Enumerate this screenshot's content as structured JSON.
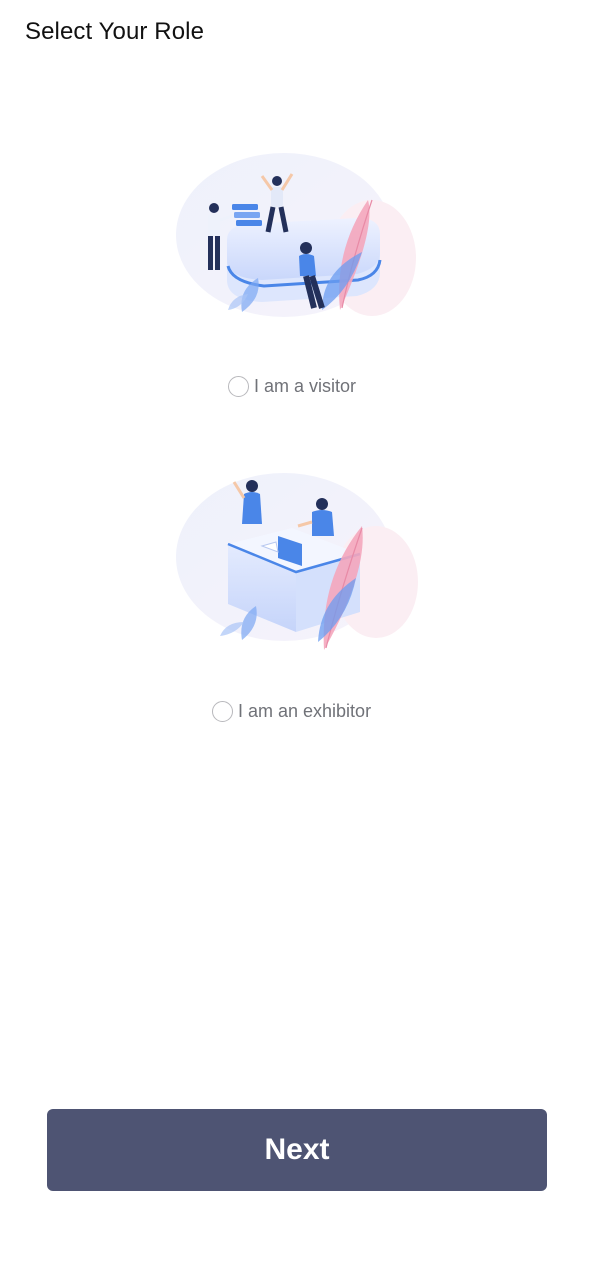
{
  "header": {
    "title": "Select Your Role"
  },
  "roles": [
    {
      "label": "I am a visitor",
      "selected": false,
      "illustration": "visitor-illustration"
    },
    {
      "label": "I am an exhibitor",
      "selected": false,
      "illustration": "exhibitor-illustration"
    }
  ],
  "footer": {
    "next_label": "Next"
  },
  "colors": {
    "button_bg": "#4e5473",
    "label_text": "#707278",
    "radio_border": "#b8b8bc",
    "illustration_blue": "#4a86e8",
    "illustration_pink": "#f4a6bd"
  }
}
